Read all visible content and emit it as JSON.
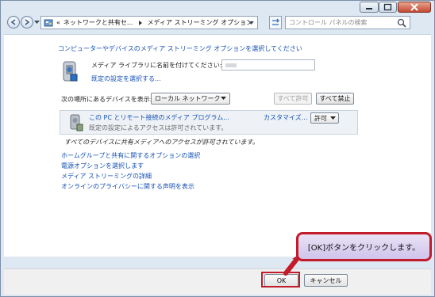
{
  "titlebar": {
    "buttons": [
      "minimize",
      "maximize",
      "close"
    ]
  },
  "navbar": {
    "breadcrumb_prefix": "«",
    "breadcrumb": [
      "ネットワークと共有セ...",
      "メディア ストリーミング オプション"
    ],
    "search_placeholder": "コントロール パネルの検索"
  },
  "content": {
    "heading": "コンピューターやデバイスのメディア ストリーミング オプションを選択してください",
    "library_label": "メディア ライブラリに名前を付けてください:",
    "library_name": "",
    "default_settings_link": "既定の設定を選択する...",
    "show_devices_label": "次の場所にあるデバイスを表示:",
    "network_select": "ローカル ネットワーク",
    "allow_all": "すべて許可",
    "block_all": "すべて禁止",
    "device": {
      "name": "この PC とリモート接続のメディア プログラム...",
      "status": "既定の設定によるアクセスは許可されています。",
      "customize": "カスタマイズ...",
      "permission": "許可"
    },
    "summary": "すべてのデバイスに共有メディアへのアクセスが許可されています。",
    "links": [
      "ホームグループと共有に関するオプションの選択",
      "電源オプションを選択します",
      "メディア ストリーミングの詳細",
      "オンラインのプライバシーに関する声明を表示"
    ]
  },
  "footer": {
    "ok": "OK",
    "cancel": "キャンセル"
  },
  "callout": {
    "text": "[OK]ボタンをクリックします。"
  },
  "colors": {
    "link": "#1450b4",
    "highlight": "#c21b2a",
    "callout_bg": "#d9d0f0"
  }
}
